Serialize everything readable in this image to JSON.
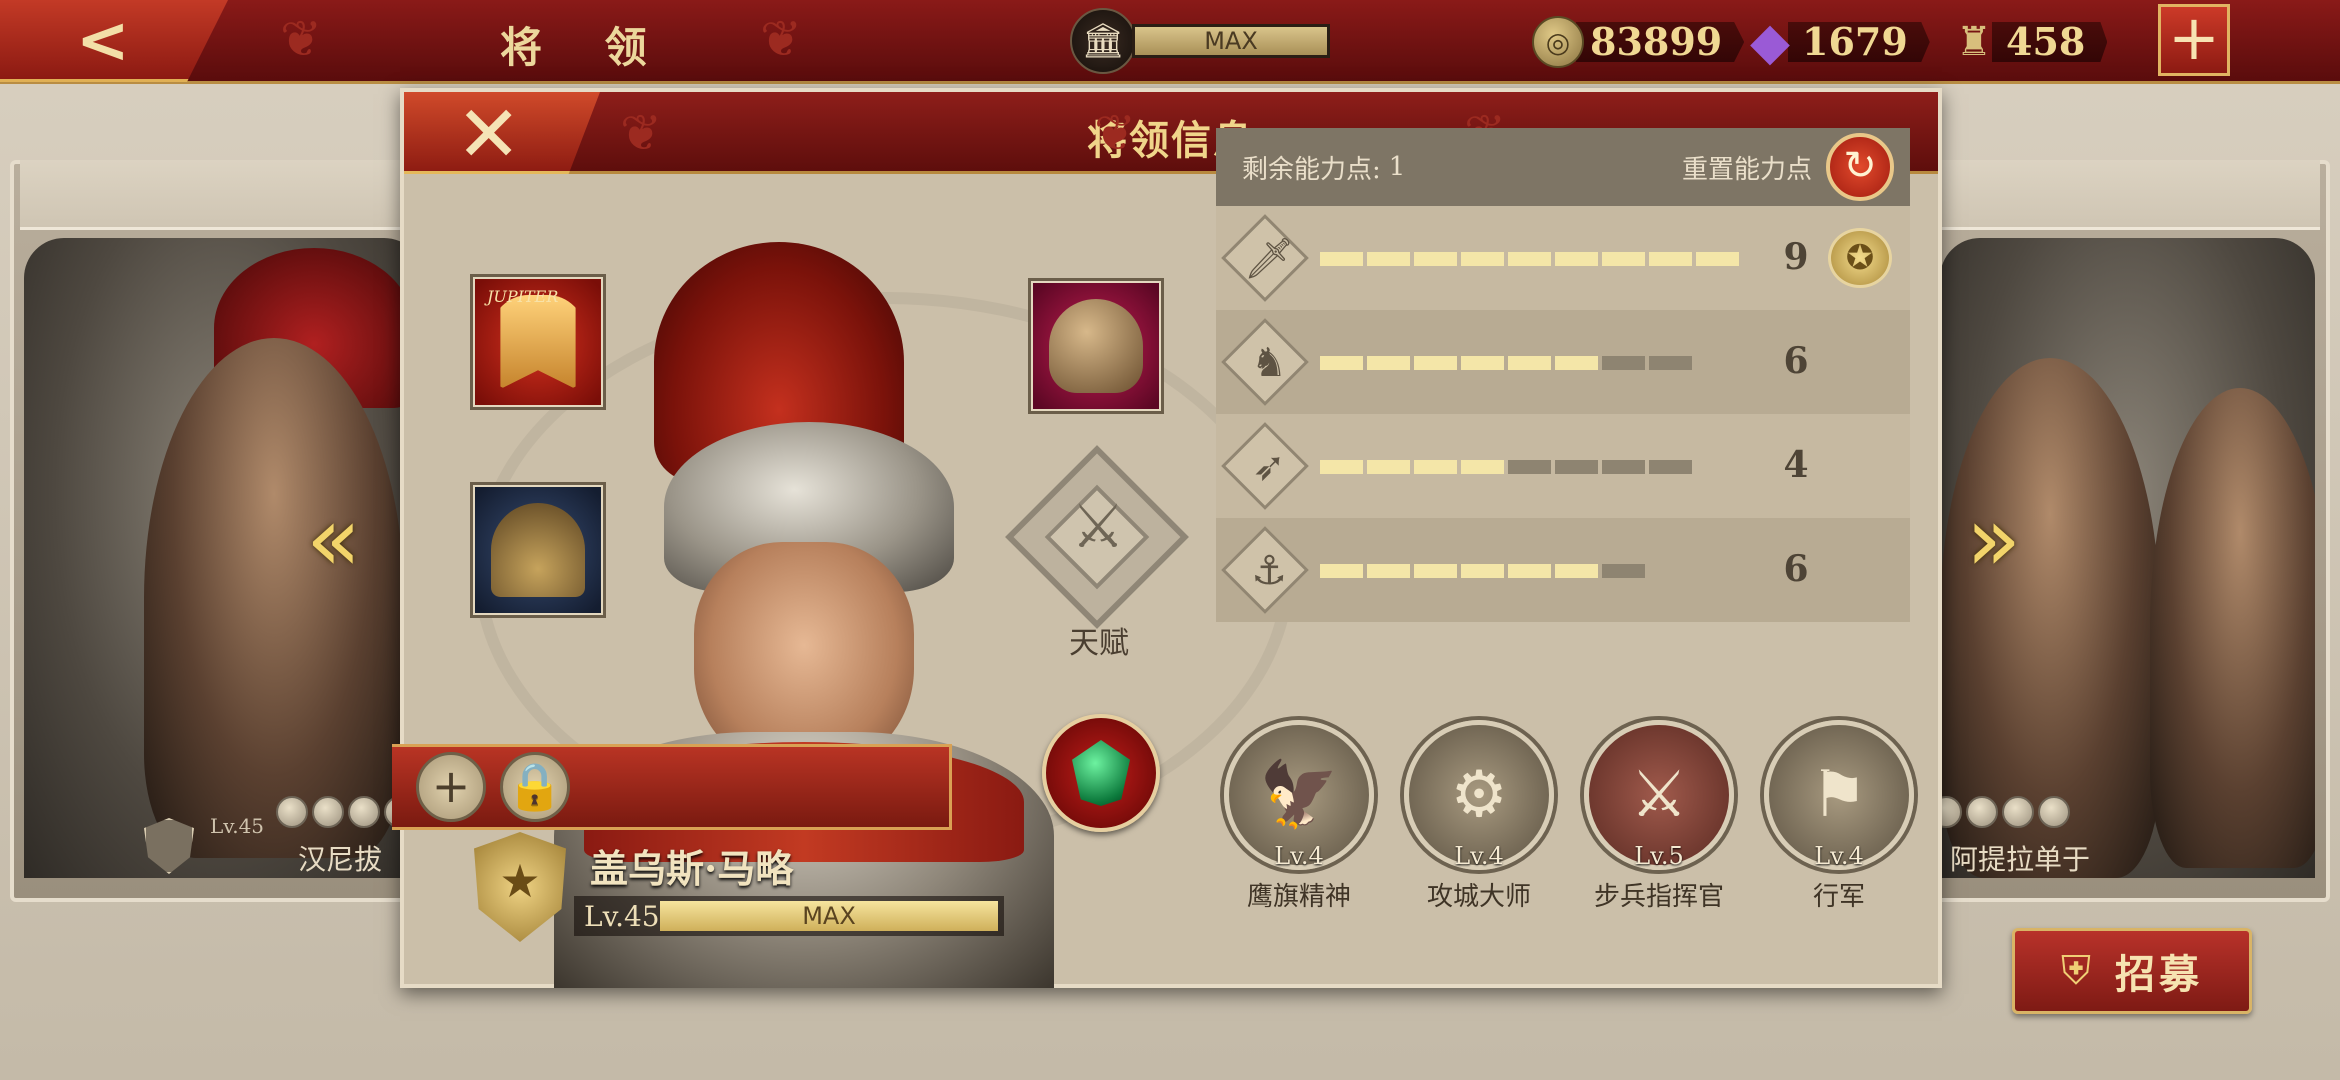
{
  "topbar": {
    "title": "将 领",
    "building_level": "MAX",
    "resources": {
      "coins": "83899",
      "gems": "1679",
      "tokens": "458"
    },
    "add_label": "+"
  },
  "background_heroes": {
    "left": {
      "name": "汉尼拔",
      "level": "Lv.45"
    },
    "right": {
      "name": "阿提拉单于"
    }
  },
  "recruit": {
    "label": "招募"
  },
  "modal": {
    "title": "将领信息",
    "equipment": {
      "banner_text": "JUPITER"
    },
    "talent_label": "天赋",
    "hero": {
      "name": "盖乌斯·马略",
      "level": "Lv.45",
      "exp_label": "MAX"
    },
    "stats": {
      "remaining_label": "剩余能力点:",
      "remaining_value": "1",
      "reset_label": "重置能力点",
      "rows": [
        {
          "icon": "sword-icon",
          "value": "9",
          "filled": 9,
          "total": 9
        },
        {
          "icon": "horse-icon",
          "value": "6",
          "filled": 6,
          "total": 8
        },
        {
          "icon": "bow-icon",
          "value": "4",
          "filled": 4,
          "total": 8
        },
        {
          "icon": "anchor-icon",
          "value": "6",
          "filled": 6,
          "total": 7
        }
      ]
    },
    "skills": [
      {
        "level": "Lv.4",
        "name": "鹰旗精神"
      },
      {
        "level": "Lv.4",
        "name": "攻城大师"
      },
      {
        "level": "Lv.5",
        "name": "步兵指挥官"
      },
      {
        "level": "Lv.4",
        "name": "行军"
      }
    ]
  },
  "colors": {
    "header_red": "#8e1e1a",
    "gold": "#f0d58a",
    "bar_on": "#f4e6a8",
    "bar_off": "#8e8471"
  }
}
